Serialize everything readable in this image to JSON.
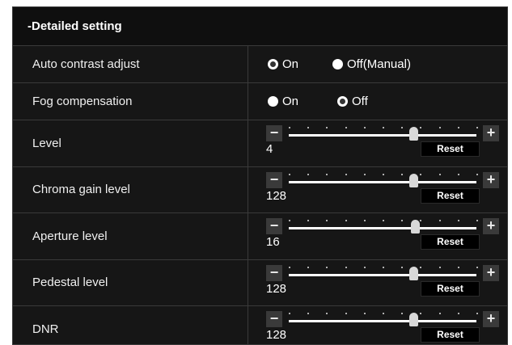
{
  "section_title": "-Detailed setting",
  "auto_contrast": {
    "label": "Auto contrast adjust",
    "options": [
      "On",
      "Off(Manual)"
    ],
    "selected": "On"
  },
  "fog": {
    "label": "Fog compensation",
    "options": [
      "On",
      "Off"
    ],
    "selected": "Off"
  },
  "sliders": [
    {
      "label": "Level",
      "value": "4",
      "reset_label": "Reset",
      "position": 0.66
    },
    {
      "label": "Chroma gain level",
      "value": "128",
      "reset_label": "Reset",
      "position": 0.66
    },
    {
      "label": "Aperture level",
      "value": "16",
      "reset_label": "Reset",
      "position": 0.67
    },
    {
      "label": "Pedestal level",
      "value": "128",
      "reset_label": "Reset",
      "position": 0.66
    },
    {
      "label": "DNR",
      "value": "128",
      "reset_label": "Reset",
      "position": 0.66
    }
  ],
  "icons": {
    "minus": "minus-icon",
    "plus": "plus-icon"
  },
  "colors": {
    "panel": "#161616",
    "divider": "#3a3a3a",
    "reset_bg": "#000000"
  }
}
